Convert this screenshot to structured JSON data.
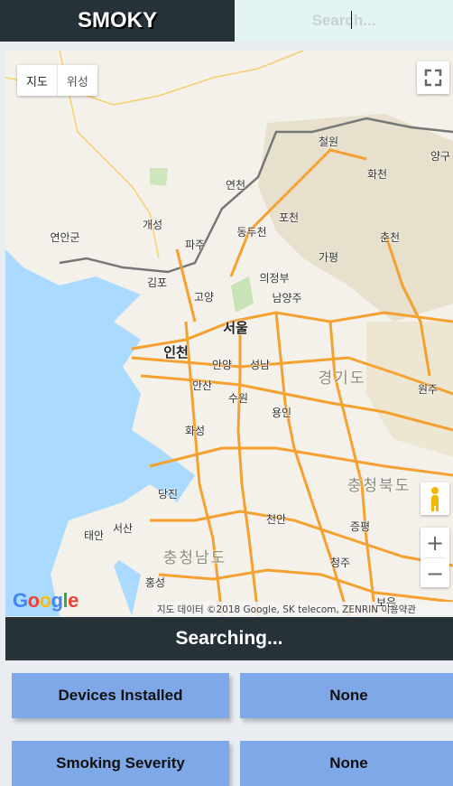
{
  "header": {
    "brand": "SMOKY",
    "search_placeholder": "Search..."
  },
  "map": {
    "map_type_options": [
      "지도",
      "위성"
    ],
    "labels": [
      "철원",
      "양구",
      "화천",
      "연천",
      "포천",
      "춘천",
      "동두천",
      "개성",
      "연안군",
      "파주",
      "가평",
      "의정부",
      "김포",
      "고양",
      "남양주",
      "서울",
      "인천",
      "안양",
      "성남",
      "경기도",
      "안산",
      "수원",
      "용인",
      "원주",
      "화성",
      "충청북도",
      "당진",
      "천안",
      "증평",
      "태안",
      "서산",
      "충청남도",
      "홍성",
      "청주",
      "보은"
    ],
    "logo": "Google",
    "attribution": "지도 데이터 ©2018 Google, SK telecom, ZENRIN    이용약관"
  },
  "status": {
    "text": "Searching..."
  },
  "stats": [
    {
      "label": "Devices Installed",
      "value": "None"
    },
    {
      "label": "Smoking Severity",
      "value": "None"
    }
  ],
  "colors": {
    "header_bg": "#263238",
    "search_bg": "#e2f5f3",
    "card_bg": "#7fa8e8",
    "road": "#f4a130"
  }
}
